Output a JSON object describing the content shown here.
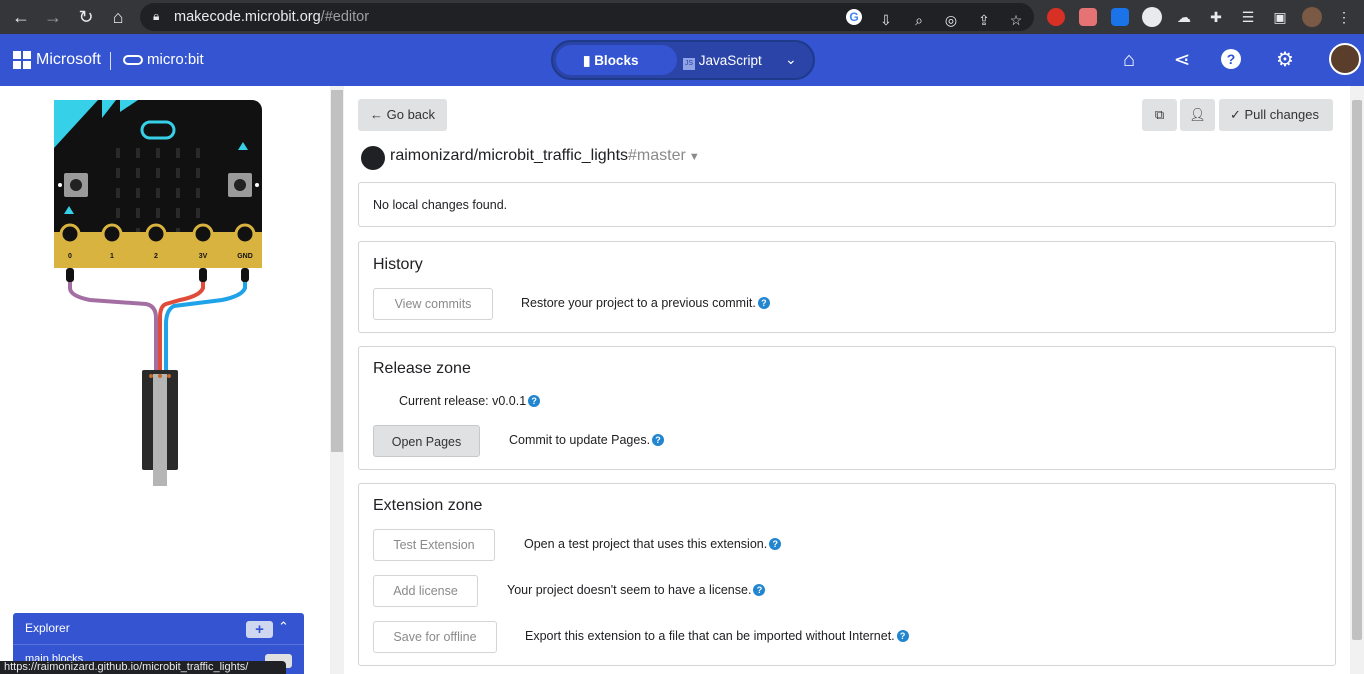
{
  "browser": {
    "url_host": "makecode.microbit.org",
    "url_path": "/#editor",
    "status_url": "https://raimonizard.github.io/microbit_traffic_lights/"
  },
  "header": {
    "brand": "Microsoft",
    "product": "micro:bit",
    "tabs": [
      {
        "label": "Blocks",
        "active": true
      },
      {
        "label": "JavaScript",
        "active": false
      }
    ]
  },
  "explorer": {
    "title": "Explorer",
    "items": [
      "main.blocks"
    ]
  },
  "github": {
    "back_label": "Go back",
    "pull_label": "Pull changes",
    "repo": "raimonizard/microbit_traffic_lights",
    "branch": "#master",
    "status": "No local changes found.",
    "history": {
      "title": "History",
      "button": "View commits",
      "description": "Restore your project to a previous commit."
    },
    "release": {
      "title": "Release zone",
      "current": "Current release: v0.0.1",
      "button": "Open Pages",
      "description": "Commit to update Pages."
    },
    "extension": {
      "title": "Extension zone",
      "rows": [
        {
          "button": "Test Extension",
          "description": "Open a test project that uses this extension."
        },
        {
          "button": "Add license",
          "description": "Your project doesn't seem to have a license."
        },
        {
          "button": "Save for offline",
          "description": "Export this extension to a file that can be imported without Internet."
        }
      ]
    }
  },
  "colors": {
    "appbar": "#3454d1",
    "help": "#2185d0"
  }
}
